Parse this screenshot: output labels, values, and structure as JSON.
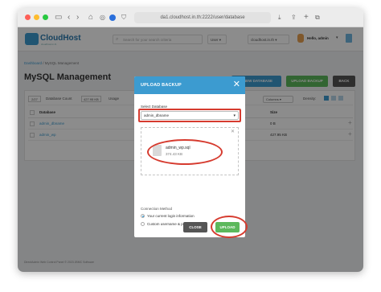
{
  "browser": {
    "url": "da1.cloudhost.in.th:2222/user/database",
    "colors": {
      "close": "#fe5f57",
      "minimize": "#febc2e",
      "maximize": "#28c840"
    }
  },
  "header": {
    "logo_text": "CloudHost",
    "logo_sub": "cloudhost.in.th",
    "search_placeholder": "Search for your search criteria",
    "role": "User",
    "domain": "cloudhost.in.th",
    "greeting": "Hello, admin"
  },
  "breadcrumb": {
    "root": "Dashboard",
    "separator": " / ",
    "current": "MySQL Management"
  },
  "page_title": "MySQL Management",
  "actions": {
    "new_database": "+ NEW DATABASE",
    "upload_backup": "UPLOAD BACKUP",
    "back": "BACK"
  },
  "toolbar": {
    "count": "2/27",
    "count_label": "Database Count",
    "usage": "427.95 KB",
    "usage_label": "Usage",
    "columns": "Columns",
    "density": "Density:"
  },
  "table": {
    "headers": [
      "Database",
      "Size"
    ],
    "rows": [
      {
        "name": "admin_dbname",
        "size": "0 B"
      },
      {
        "name": "admin_wp",
        "size": "427.95 KB"
      }
    ]
  },
  "modal": {
    "title": "UPLOAD BACKUP",
    "select_label": "Select Database",
    "selected_db": "admin_dbname",
    "file_name": "admin_wp.sql",
    "file_size": "374.43 KB",
    "connection_label": "Connection Method",
    "options": [
      "Your current login information",
      "Custom username & password"
    ],
    "close_label": "CLOSE",
    "upload_label": "UPLOAD"
  },
  "footer": "DirectAdmin Web Control Panel © 2023 JBMC Software"
}
